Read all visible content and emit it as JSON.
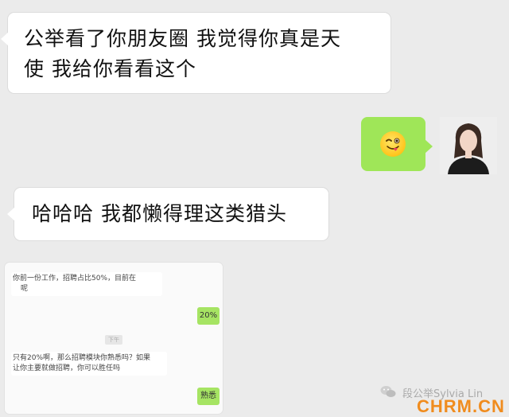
{
  "messages": {
    "m1_line1": "公举看了你朋友圈 我觉得你真是天",
    "m1_line2": "使 我给你看看这个",
    "m2_emoji": "wink-tongue-emoji",
    "m3": "哈哈哈 我都懒得理这类猎头"
  },
  "embedded": {
    "q1_line1": "你前一份工作，招聘占比50%，目前在",
    "q1_line2": "呢",
    "a1": "20%",
    "time": "下午",
    "q2_line1": "只有20%啊，那么招聘模块你熟悉吗？如果",
    "q2_line2": "让你主要就做招聘，你可以胜任吗",
    "a2": "熟悉"
  },
  "watermark": {
    "account": "段公举Sylvia Lin",
    "site": "CHRM.CN"
  },
  "colors": {
    "background": "#ebebeb",
    "sent_bubble": "#9fe658",
    "received_bubble": "#ffffff",
    "brand_orange": "#f08c1e"
  }
}
